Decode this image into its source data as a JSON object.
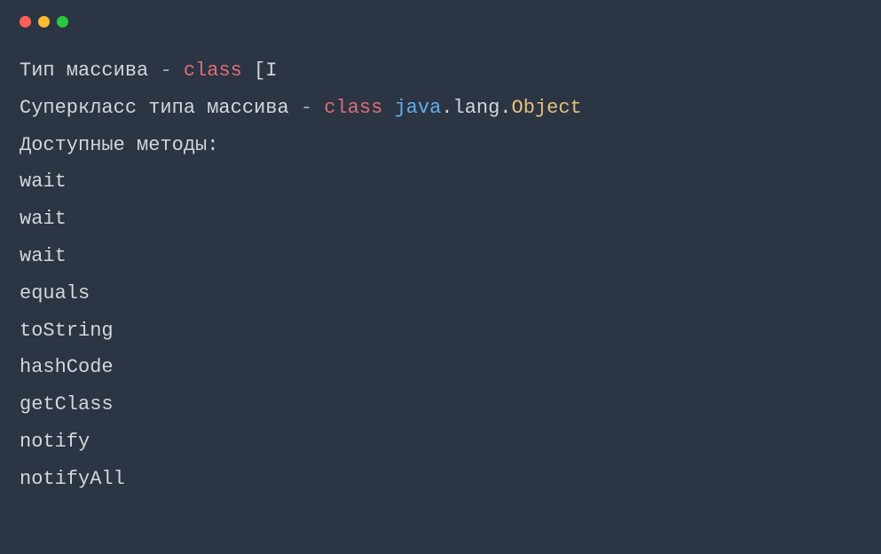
{
  "window": {
    "controls": {
      "close": "close",
      "minimize": "minimize",
      "maximize": "maximize"
    }
  },
  "code": {
    "line1": {
      "t1": "Тип массива ",
      "t2": "-",
      "t3": " ",
      "t4": "class",
      "t5": " [I"
    },
    "line2": {
      "t1": "Суперкласс типа массива ",
      "t2": "-",
      "t3": " ",
      "t4": "class",
      "t5": " ",
      "t6": "java",
      "t7": ".lang.",
      "t8": "Object"
    },
    "line3": "Доступные методы:",
    "line4": "wait",
    "line5": "wait",
    "line6": "wait",
    "line7": "equals",
    "line8": "toString",
    "line9": "hashCode",
    "line10": "getClass",
    "line11": "notify",
    "line12": "notifyAll"
  }
}
